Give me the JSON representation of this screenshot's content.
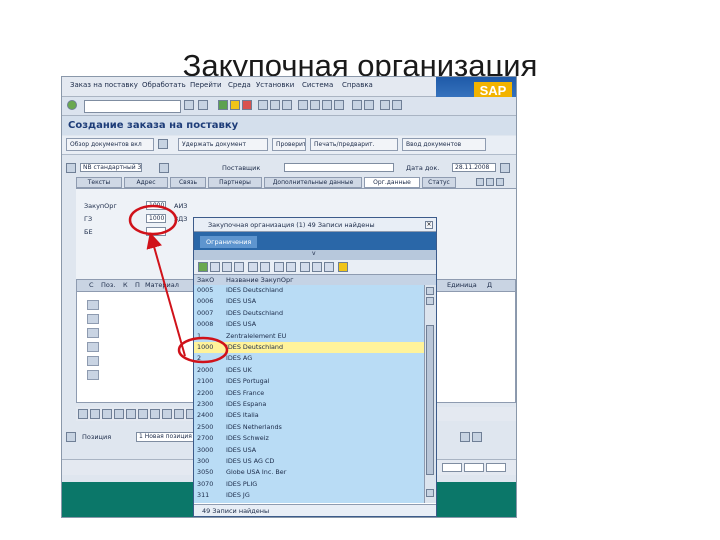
{
  "slide": {
    "title": "Закупочная организация"
  },
  "sap": {
    "menu": [
      "Заказ на поставку",
      "Обработать",
      "Перейти",
      "Среда",
      "Установки",
      "Система",
      "Справка"
    ],
    "transaction_title": "Создание заказа на поставку",
    "app_toolbar": [
      "Обзор документов вкл",
      "Удержать документ",
      "Проверить",
      "Печать/предварит.",
      "Ввод документов"
    ],
    "header": {
      "doc_type": "NB стандартный ЗП",
      "supplier_label": "Поставщик",
      "doc_date_label": "Дата док.",
      "doc_date_value": "28.11.2008"
    },
    "tabs": [
      "Тексты",
      "Адрес",
      "Связь",
      "Партнеры",
      "Дополнительные данные",
      "Орг.данные",
      "Статус"
    ],
    "org": {
      "purch_org_label": "ЗакупОрг",
      "purch_org_value": "1000",
      "purch_group_label": "ГЗ",
      "purch_group_value": "1000",
      "company_label": "БЕ",
      "purch_org_suffix": "АИЗ",
      "purch_group_suffix": "ЗДЗ"
    },
    "grid_headers": [
      "С",
      "Поз.",
      "К",
      "П",
      "Материал",
      "Единица",
      "Д"
    ],
    "item_label": "Позиция",
    "item_value": "1 Новая позиция"
  },
  "popup": {
    "title": "Закупочная организация (1) 49 Записи найдены",
    "tab": "Ограничения",
    "columns": [
      "ЗакО",
      "Название ЗакупОрг"
    ],
    "rows": [
      {
        "code": "0005",
        "name": "IDES Deutschland"
      },
      {
        "code": "0006",
        "name": "IDES USA"
      },
      {
        "code": "0007",
        "name": "IDES Deutschland"
      },
      {
        "code": "0008",
        "name": "IDES USA"
      },
      {
        "code": "1",
        "name": "Zentralelement EU"
      },
      {
        "code": "1000",
        "name": "IDES Deutschland",
        "selected": true
      },
      {
        "code": "2",
        "name": "IDES AG"
      },
      {
        "code": "2000",
        "name": "IDES UK"
      },
      {
        "code": "2100",
        "name": "IDES Portugal"
      },
      {
        "code": "2200",
        "name": "IDES France"
      },
      {
        "code": "2300",
        "name": "IDES Espana"
      },
      {
        "code": "2400",
        "name": "IDES Italia"
      },
      {
        "code": "2500",
        "name": "IDES Netherlands"
      },
      {
        "code": "2700",
        "name": "IDES Schweiz"
      },
      {
        "code": "3000",
        "name": "IDES USA"
      },
      {
        "code": "300",
        "name": "IDES US AG CD"
      },
      {
        "code": "3050",
        "name": "Globe USA Inc. Ber"
      },
      {
        "code": "3070",
        "name": "IDES PLIG"
      },
      {
        "code": "311",
        "name": "IDES JG"
      }
    ],
    "status": "49 Записи найдены"
  }
}
